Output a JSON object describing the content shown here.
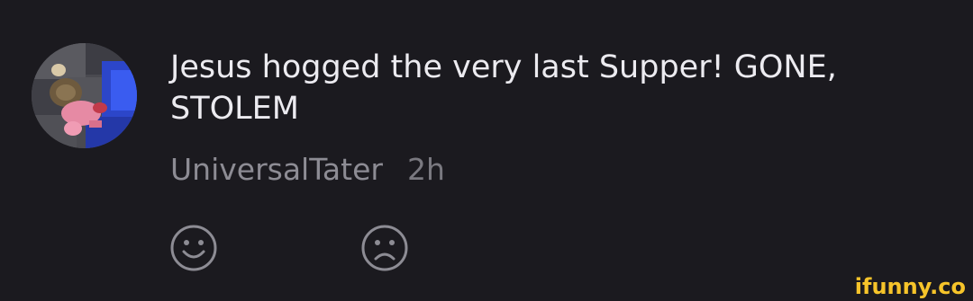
{
  "comment": {
    "avatar_icon": "user-avatar-pink-character",
    "text": "Jesus hogged the very last Supper! GONE,\nSTOLEM",
    "username": "UniversalTater",
    "timestamp": "2h"
  },
  "reactions": {
    "like_icon": "smile-face-icon",
    "dislike_icon": "frown-face-icon"
  },
  "watermark": {
    "text": "ifunny.co",
    "color": "#f6c42a"
  },
  "colors": {
    "background": "#1b1a1f",
    "text": "#ecebf0",
    "meta": "#8d8c94"
  }
}
